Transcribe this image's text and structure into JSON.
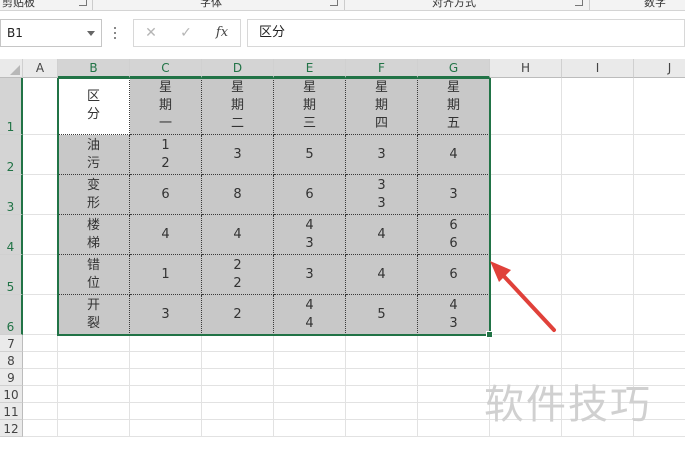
{
  "ribbon": {
    "groups": [
      "剪贴板",
      "字体",
      "对齐方式",
      "数字"
    ]
  },
  "formula_bar": {
    "name_box": "B1",
    "cancel_icon": "close-icon",
    "enter_icon": "check-icon",
    "fx_label": "fx",
    "content": "区分"
  },
  "columns": [
    "A",
    "B",
    "C",
    "D",
    "E",
    "F",
    "G",
    "H",
    "I",
    "J"
  ],
  "rows": [
    "1",
    "2",
    "3",
    "4",
    "5",
    "6",
    "7",
    "8",
    "9",
    "10",
    "11",
    "12"
  ],
  "table": {
    "header": [
      "区\n分",
      "星\n期\n一",
      "星\n期\n二",
      "星\n期\n三",
      "星\n期\n四",
      "星\n期\n五"
    ],
    "rows": [
      [
        "油\n污",
        "1\n2",
        "3",
        "5",
        "3",
        "4"
      ],
      [
        "变\n形",
        "6",
        "8",
        "6",
        "3\n3",
        "3"
      ],
      [
        "楼\n梯",
        "4",
        "4",
        "4\n3",
        "4",
        "6\n6"
      ],
      [
        "错\n位",
        "1",
        "2\n2",
        "3",
        "4",
        "6"
      ],
      [
        "开\n裂",
        "3",
        "2",
        "4\n4",
        "5",
        "4\n3"
      ]
    ]
  },
  "colors": {
    "accent": "#217346",
    "selection_fill": "#c8c8c8",
    "arrow": "#e0413a"
  },
  "watermark": "软件技巧"
}
